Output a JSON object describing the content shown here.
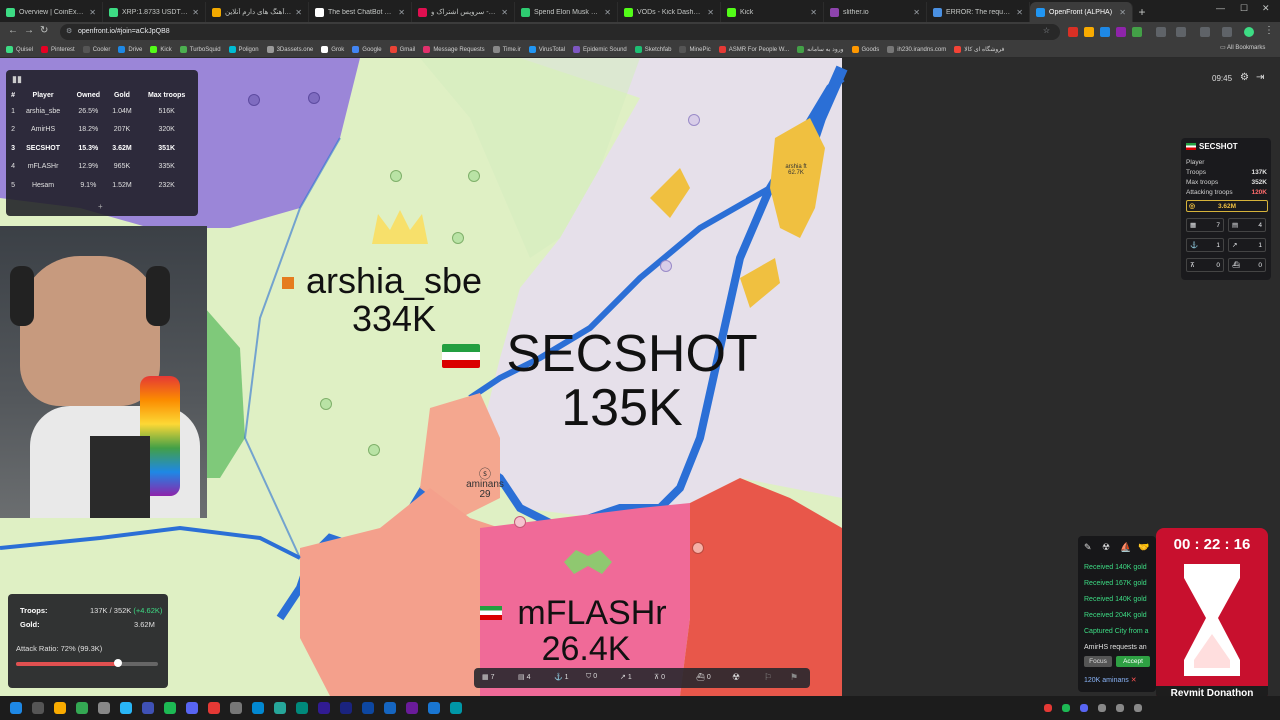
{
  "browser": {
    "tabs": [
      {
        "title": "Overview | CoinEx - The C",
        "color": "#3ddc84"
      },
      {
        "title": "XRP:1.8733 USDT | Futur",
        "color": "#3ddc84"
      },
      {
        "title": "دانلود آهنگ های دارم آنلاین",
        "color": "#f2a900"
      },
      {
        "title": "The best ChatBot and Wr",
        "color": "#ffffff"
      },
      {
        "title": "آپارات - سرویس اشتراک و",
        "color": "#df0f50"
      },
      {
        "title": "Spend Elon Musk Money",
        "color": "#2ecc71"
      },
      {
        "title": "VODs - Kick Dashboard",
        "color": "#53fc18"
      },
      {
        "title": "Kick",
        "color": "#53fc18"
      },
      {
        "title": "slither.io",
        "color": "#8e44ad"
      },
      {
        "title": "ERROR: The request coul",
        "color": "#4a90e2"
      },
      {
        "title": "OpenFront (ALPHA)",
        "color": "#2196f3"
      }
    ],
    "url": "openfront.io/#join=aCkJpQB8",
    "bookmarks": [
      "Quisel",
      "Pinterest",
      "Cooler",
      "Drive",
      "Kick",
      "TurboSquid",
      "Poligon",
      "3Dassets.one",
      "Grok",
      "Google",
      "Gmail",
      "Message Requests",
      "Time.ir",
      "VirusTotal",
      "Epidemic Sound",
      "Sketchfab",
      "MinePic",
      "ASMR For People W...",
      "ورود به سامانه",
      "Goods",
      "ih230.irandns.com",
      "فروشگاه ای کالا"
    ],
    "all_bookmarks": "All Bookmarks"
  },
  "game": {
    "clock": "09:45",
    "leaderboard": {
      "headers": [
        "#",
        "Player",
        "Owned",
        "Gold",
        "Max troops"
      ],
      "rows": [
        [
          "1",
          "arshia_sbe",
          "26.5%",
          "1.04M",
          "516K"
        ],
        [
          "2",
          "AmirHS",
          "18.2%",
          "207K",
          "320K"
        ],
        [
          "3",
          "SECSHOT",
          "15.3%",
          "3.62M",
          "351K"
        ],
        [
          "4",
          "mFLASHr",
          "12.9%",
          "965K",
          "335K"
        ],
        [
          "5",
          "Hesam",
          "9.1%",
          "1.52M",
          "232K"
        ]
      ],
      "highlight_row": 2,
      "expand": "+"
    },
    "map_labels": {
      "arshia_name": "arshia_sbe",
      "arshia_troops": "334K",
      "secshot_name": "SECSHOT",
      "secshot_troops": "135K",
      "aminans_name": "aminans",
      "aminans_troops": "29",
      "mflash_name": "mFLASHr",
      "mflash_troops": "26.4K",
      "arshia_ft": "arshia ft",
      "arshia_ft_troops": "62.7K"
    },
    "player_panel": {
      "name": "SECSHOT",
      "type": "Player",
      "rows": [
        {
          "label": "Troops",
          "value": "137K"
        },
        {
          "label": "Max troops",
          "value": "352K"
        },
        {
          "label": "Attacking troops",
          "value": "120K"
        }
      ],
      "gold": "3.62M",
      "stats": [
        "7",
        "4",
        "1",
        "1",
        "0",
        "0"
      ]
    },
    "troops_panel": {
      "troops_label": "Troops:",
      "troops_value": "137K / 352K",
      "troops_delta": "(+4.62K)",
      "gold_label": "Gold:",
      "gold_value": "3.62M",
      "attack_ratio": "Attack Ratio: 72% (99.3K)",
      "attack_ratio_fraction": 0.72
    },
    "bottom_bar": [
      "7",
      "4",
      "1",
      "0",
      "1",
      "0",
      "0"
    ],
    "events": {
      "items": [
        "Received 140K gold",
        "Received 167K gold",
        "Received 140K gold",
        "Received 204K gold",
        "Captured City from a"
      ],
      "request": "AmirHS requests an",
      "focus": "Focus",
      "accept": "Accept",
      "footer": "120K aminans"
    },
    "timer": {
      "time": "00 : 22 : 16",
      "caption": "Reymit Donathon"
    }
  },
  "colors": {
    "secshot": "#e6e0ea",
    "arshia": "#dff0c4",
    "amirhs": "#9b86d8",
    "mflash": "#f06a98",
    "hesam": "#e8574a",
    "aminans": "#f4a78f",
    "water": "#2b6fd6",
    "gold": "#f0c040",
    "accent_green": "#3ddc84",
    "timer_red": "#c8102e"
  }
}
